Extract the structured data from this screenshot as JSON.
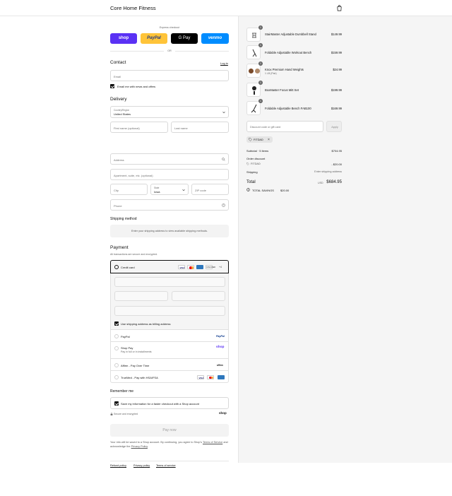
{
  "header": {
    "store_name": "Core Home Fitness"
  },
  "express": {
    "label": "Express checkout",
    "buttons": [
      "shop",
      "PayPal",
      "G Pay",
      "venmo"
    ],
    "or": "OR"
  },
  "contact": {
    "title": "Contact",
    "login": "Log in",
    "email_placeholder": "Email",
    "news_label": "Email me with news and offers"
  },
  "delivery": {
    "title": "Delivery",
    "country_label": "Country/Region",
    "country_value": "United States",
    "first_name": "First name (optional)",
    "last_name": "Last name",
    "address": "Address",
    "apartment": "Apartment, suite, etc. (optional)",
    "city": "City",
    "state_label": "State",
    "state_value": "Iowa",
    "zip": "ZIP code",
    "phone": "Phone"
  },
  "shipping": {
    "title": "Shipping method",
    "notice": "Enter your shipping address to view available shipping methods."
  },
  "payment": {
    "title": "Payment",
    "subtitle": "All transactions are secure and encrypted.",
    "credit_card": "Credit card",
    "more_cards": "+4",
    "billing_same": "Use shipping address as billing address",
    "options": [
      {
        "label": "PayPal",
        "sub": "",
        "badge": "PayPal"
      },
      {
        "label": "Shop Pay",
        "sub": "Pay in full or in installments",
        "badge": "shop"
      },
      {
        "label": "Affirm - Pay Over Time",
        "sub": "",
        "badge": "affirm"
      },
      {
        "label": "TrueMed - Pay with HSA/FSA",
        "sub": "",
        "badge": ""
      }
    ]
  },
  "remember": {
    "title": "Remember me",
    "save_label": "Save my information for a faster checkout with a Shop account",
    "secure": "Secure and encrypted",
    "shop": "shop"
  },
  "pay_now": "Pay now",
  "legal": {
    "line1": "Your info will be saved to a Shop account. By continuing, you agree to Shop's",
    "terms": "Terms of Service",
    "and": "and acknowledge the",
    "privacy": "Privacy Policy",
    "end": "."
  },
  "footer_links": [
    "Refund policy",
    "Privacy policy",
    "Terms of service"
  ],
  "cart": {
    "items": [
      {
        "name": "StairMaster Adjustable Dumbbell Stand",
        "variant": "",
        "qty": "1",
        "price": "$149.99"
      },
      {
        "name": "Foldable Adjustable Workout Bench",
        "variant": "",
        "qty": "1",
        "price": "$159.99"
      },
      {
        "name": "Knox Premium Hand Weights",
        "variant": "1 LB (Pair)",
        "qty": "1",
        "price": "$24.99"
      },
      {
        "name": "BoxMaster Focus Mitt Set",
        "variant": "",
        "qty": "1",
        "price": "$199.99"
      },
      {
        "name": "Foldable Adjustable Bench FAB100",
        "variant": "",
        "qty": "1",
        "price": "$169.99"
      }
    ],
    "discount_placeholder": "Discount code or gift card",
    "apply": "Apply",
    "code_chip": "FITDAD",
    "subtotal_label": "Subtotal · 5 items",
    "subtotal_value": "$704.95",
    "order_discount_label": "Order discount",
    "discount_code": "FITDAD",
    "discount_value": "- $20.00",
    "shipping_label": "Shipping",
    "shipping_value": "Enter shipping address",
    "total_label": "Total",
    "currency": "USD",
    "total_value": "$684.95",
    "savings_label": "TOTAL SAVINGS",
    "savings_value": "$20.00"
  },
  "colors": {
    "shop": "#5a31f4",
    "paypal": "#ffc439",
    "gpay": "#000000",
    "venmo": "#008cff"
  }
}
